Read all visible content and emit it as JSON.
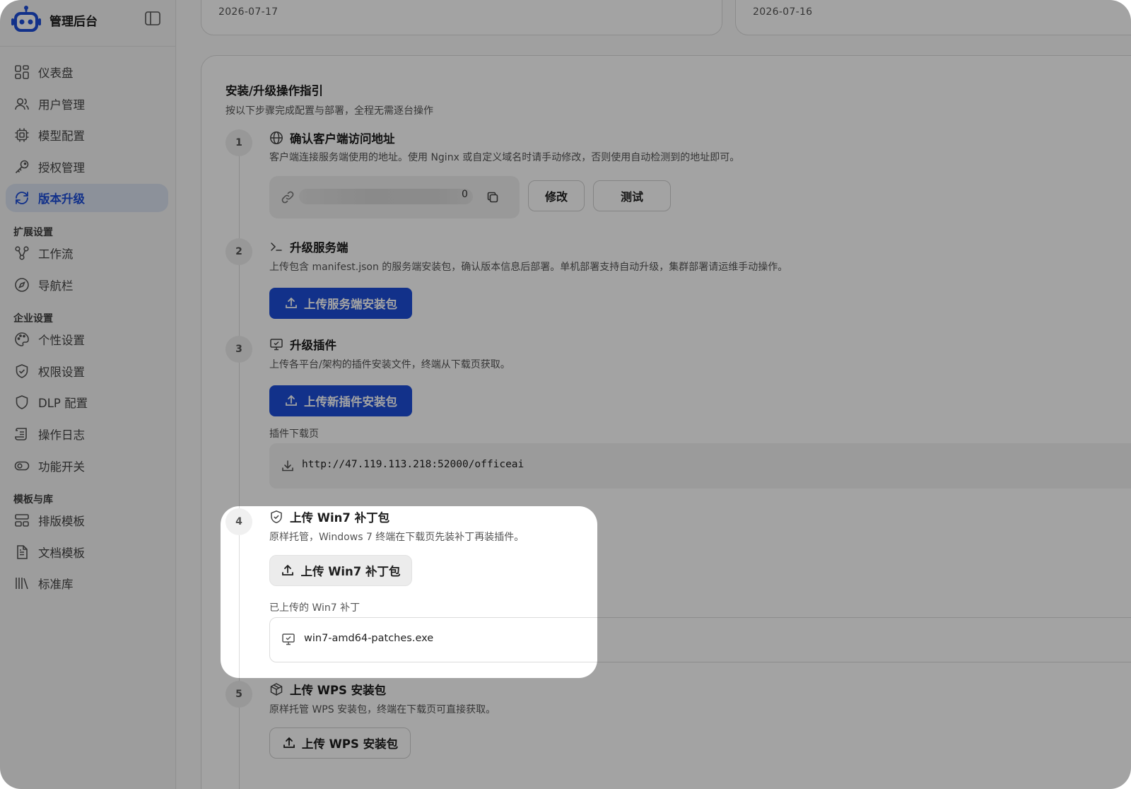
{
  "app": {
    "name": "管理后台"
  },
  "sidebar": {
    "items": [
      {
        "label": "仪表盘",
        "icon": "dashboard-icon"
      },
      {
        "label": "用户管理",
        "icon": "users-icon"
      },
      {
        "label": "模型配置",
        "icon": "cpu-icon"
      },
      {
        "label": "授权管理",
        "icon": "key-icon"
      },
      {
        "label": "版本升级",
        "icon": "refresh-icon",
        "active": true
      }
    ],
    "groups": [
      {
        "title": "扩展设置",
        "items": [
          {
            "label": "工作流",
            "icon": "workflow-icon"
          },
          {
            "label": "导航栏",
            "icon": "compass-icon"
          }
        ]
      },
      {
        "title": "企业设置",
        "items": [
          {
            "label": "个性设置",
            "icon": "palette-icon"
          },
          {
            "label": "权限设置",
            "icon": "shield-check-icon"
          },
          {
            "label": "DLP 配置",
            "icon": "shield-icon"
          },
          {
            "label": "操作日志",
            "icon": "scroll-icon"
          },
          {
            "label": "功能开关",
            "icon": "toggle-icon"
          }
        ]
      },
      {
        "title": "模板与库",
        "items": [
          {
            "label": "排版模板",
            "icon": "layout-icon"
          },
          {
            "label": "文档模板",
            "icon": "document-icon"
          },
          {
            "label": "标准库",
            "icon": "library-icon"
          }
        ]
      }
    ]
  },
  "dates": {
    "left": "2026-07-17",
    "right": "2026-07-16"
  },
  "guide": {
    "title": "安装/升级操作指引",
    "subtitle": "按以下步骤完成配置与部署，全程无需逐台操作",
    "steps": [
      {
        "num": "1",
        "icon": "globe-icon",
        "title": "确认客户端访问地址",
        "desc": "客户端连接服务端使用的地址。使用 Nginx 或自定义域名时请手动修改，否则使用自动检测到的地址即可。",
        "url_tail": "0",
        "edit_label": "修改",
        "test_label": "测试"
      },
      {
        "num": "2",
        "icon": "terminal-icon",
        "title": "升级服务端",
        "desc": "上传包含 manifest.json 的服务端安装包，确认版本信息后部署。单机部署支持自动升级，集群部署请运维手动操作。",
        "button": "上传服务端安装包"
      },
      {
        "num": "3",
        "icon": "monitor-icon",
        "title": "升级插件",
        "desc": "上传各平台/架构的插件安装文件，终端从下载页获取。",
        "button": "上传新插件安装包",
        "download_label": "插件下载页",
        "download_url": "http://47.119.113.218:52000/officeai"
      },
      {
        "num": "4",
        "icon": "shield-check-icon",
        "title": "上传 Win7 补丁包",
        "desc": "原样托管，Windows 7 终端在下载页先装补丁再装插件。",
        "button": "上传 Win7 补丁包",
        "uploaded_label": "已上传的 Win7 补丁",
        "file_name": "win7-amd64-patches.exe"
      },
      {
        "num": "5",
        "icon": "package-icon",
        "title": "上传 WPS 安装包",
        "desc": "原样托管 WPS 安装包，终端在下载页可直接获取。",
        "button": "上传 WPS 安装包"
      }
    ]
  }
}
